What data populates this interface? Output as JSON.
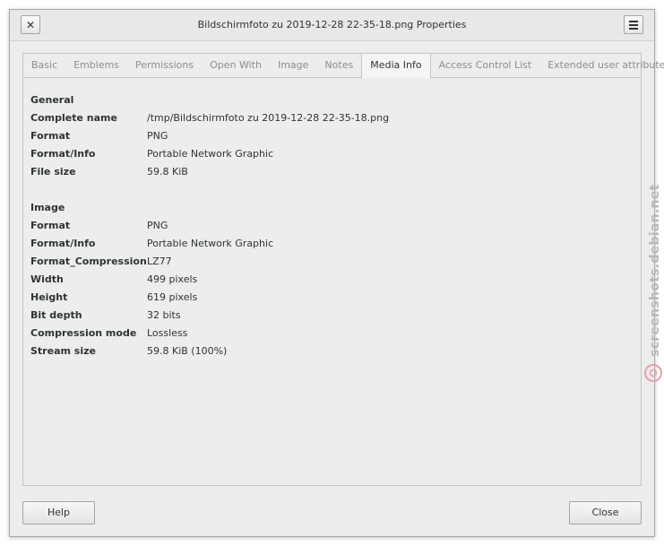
{
  "window": {
    "title": "Bildschirmfoto zu 2019-12-28 22-35-18.png Properties",
    "close_glyph": "✕"
  },
  "tabs": [
    {
      "label": "Basic",
      "active": false
    },
    {
      "label": "Emblems",
      "active": false
    },
    {
      "label": "Permissions",
      "active": false
    },
    {
      "label": "Open With",
      "active": false
    },
    {
      "label": "Image",
      "active": false
    },
    {
      "label": "Notes",
      "active": false
    },
    {
      "label": "Media Info",
      "active": true
    },
    {
      "label": "Access Control List",
      "active": false
    },
    {
      "label": "Extended user attributes",
      "active": false
    }
  ],
  "general": {
    "heading": "General",
    "rows": [
      {
        "key": "Complete name",
        "value": "/tmp/Bildschirmfoto zu 2019-12-28 22-35-18.png"
      },
      {
        "key": "Format",
        "value": "PNG"
      },
      {
        "key": "Format/Info",
        "value": "Portable Network Graphic"
      },
      {
        "key": "File size",
        "value": "59.8 KiB"
      }
    ]
  },
  "image": {
    "heading": "Image",
    "rows": [
      {
        "key": "Format",
        "value": "PNG"
      },
      {
        "key": "Format/Info",
        "value": "Portable Network Graphic"
      },
      {
        "key": "Format_Compression",
        "value": "LZ77"
      },
      {
        "key": "Width",
        "value": "499 pixels"
      },
      {
        "key": "Height",
        "value": "619 pixels"
      },
      {
        "key": "Bit depth",
        "value": "32 bits"
      },
      {
        "key": "Compression mode",
        "value": "Lossless"
      },
      {
        "key": "Stream size",
        "value": "59.8 KiB (100%)"
      }
    ]
  },
  "buttons": {
    "help": "Help",
    "close": "Close"
  },
  "watermark": {
    "text": "screenshots.debian.net"
  },
  "colors": {
    "watermark": "#e8a0a8"
  }
}
